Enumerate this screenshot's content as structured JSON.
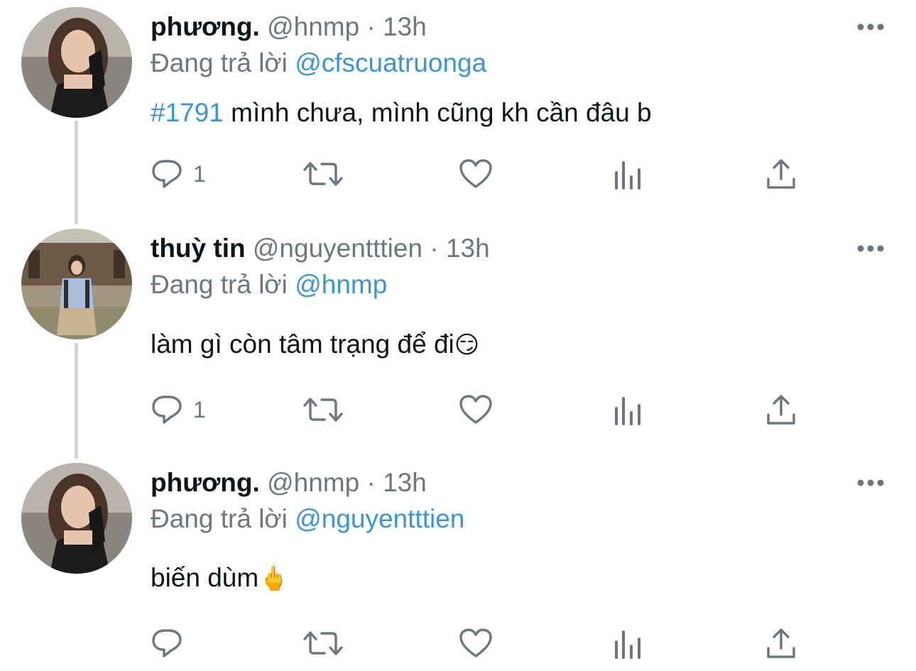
{
  "tweets": [
    {
      "name": "phương.",
      "handle": "@hnmp",
      "dot": "·",
      "time": "13h",
      "reply_prefix": "Đang trả lời",
      "reply_to": "@cfscuatruonga",
      "hashtag": "#1791",
      "text": " mình chưa, mình cũng kh cần đâu b",
      "emoji": "",
      "reply_count": "1",
      "avatar": "woman-black-gloves-avatar"
    },
    {
      "name": "thuỳ tin",
      "handle": "@nguyentttien",
      "dot": "·",
      "time": "13h",
      "reply_prefix": "Đang trả lời",
      "reply_to": "@hnmp",
      "hashtag": "",
      "text": "làm gì còn tâm trạng để đi",
      "emoji": "😏",
      "reply_count": "1",
      "avatar": "woman-outdoor-photo-avatar"
    },
    {
      "name": "phương.",
      "handle": "@hnmp",
      "dot": "·",
      "time": "13h",
      "reply_prefix": "Đang trả lời",
      "reply_to": "@nguyentttien",
      "hashtag": "",
      "text": "biến dùm",
      "emoji": "🖕",
      "reply_count": "",
      "avatar": "woman-black-gloves-avatar"
    }
  ],
  "icons": {
    "reply": "reply-icon",
    "retweet": "retweet-icon",
    "like": "like-heart-icon",
    "views": "views-chart-icon",
    "share": "share-upload-icon",
    "more": "more-options-icon"
  },
  "colors": {
    "link": "#3b94d9",
    "muted": "#6e767d",
    "text": "#0f1419",
    "thread_line": "#d0d6db"
  }
}
